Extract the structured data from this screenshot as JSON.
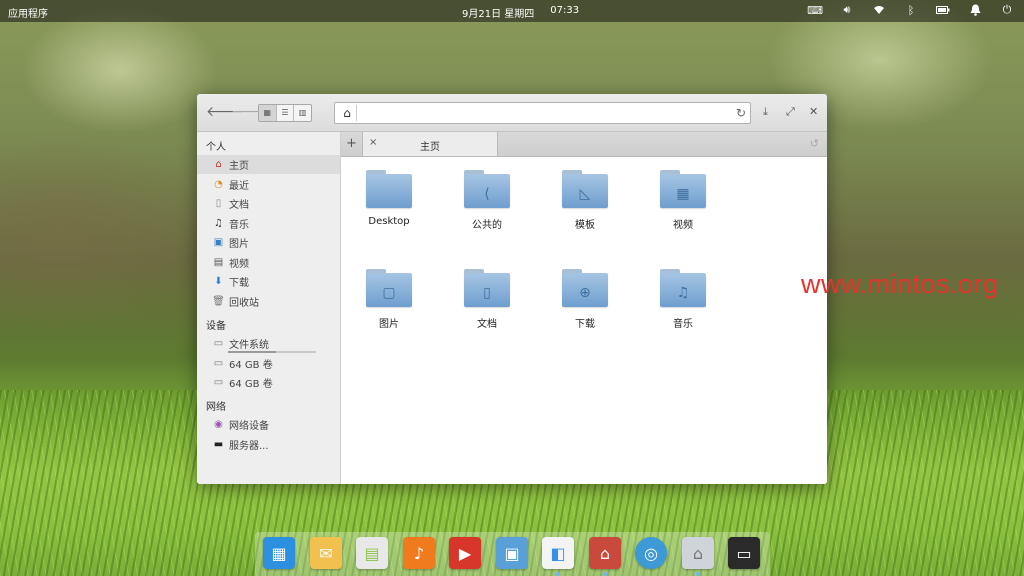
{
  "panel": {
    "apps_label": "应用程序",
    "date": "9月21日 星期四",
    "time": "07:33",
    "tray_icons": [
      "keyboard-icon",
      "volume-icon",
      "wifi-icon",
      "bluetooth-icon",
      "battery-icon",
      "notification-bell-icon",
      "power-icon"
    ]
  },
  "window": {
    "toolbar": {
      "back": "back-arrow-icon",
      "forward": "forward-arrow-icon",
      "view_modes": [
        "icon-view",
        "list-view",
        "column-view"
      ],
      "address_home": "home-icon",
      "address_text": "",
      "reload": "reload-icon",
      "controls": [
        "download-icon",
        "maximize-icon",
        "close-icon"
      ]
    },
    "sidebar": {
      "personal_title": "个人",
      "personal": [
        {
          "label": "主页",
          "icon": "home-icon",
          "selected": true
        },
        {
          "label": "最近",
          "icon": "recent-icon"
        },
        {
          "label": "文档",
          "icon": "document-icon"
        },
        {
          "label": "音乐",
          "icon": "music-icon"
        },
        {
          "label": "图片",
          "icon": "picture-icon"
        },
        {
          "label": "视频",
          "icon": "video-icon"
        },
        {
          "label": "下载",
          "icon": "download-icon"
        },
        {
          "label": "回收站",
          "icon": "trash-icon"
        }
      ],
      "devices_title": "设备",
      "devices": [
        {
          "label": "文件系统",
          "icon": "drive-icon",
          "usage": 0.55
        },
        {
          "label": "64 GB 卷",
          "icon": "drive-icon"
        },
        {
          "label": "64 GB 卷",
          "icon": "drive-icon"
        }
      ],
      "network_title": "网络",
      "network": [
        {
          "label": "网络设备",
          "icon": "network-icon"
        },
        {
          "label": "服务器...",
          "icon": "server-icon"
        }
      ]
    },
    "tabs": {
      "add": "+",
      "close": "×",
      "active_title": "主页"
    },
    "folders": [
      {
        "name": "Desktop",
        "glyph": ""
      },
      {
        "name": "公共的",
        "glyph": "⟨"
      },
      {
        "name": "模板",
        "glyph": "◺"
      },
      {
        "name": "视频",
        "glyph": "▦"
      },
      {
        "name": "图片",
        "glyph": "▢"
      },
      {
        "name": "文档",
        "glyph": "▯"
      },
      {
        "name": "下载",
        "glyph": "⊕"
      },
      {
        "name": "音乐",
        "glyph": "♫"
      }
    ]
  },
  "watermark": "www.mintos.org",
  "dock": {
    "items": [
      {
        "name": "multitasking-icon",
        "color": "#2d8fe0"
      },
      {
        "name": "mail-icon",
        "color": "#f2c04e"
      },
      {
        "name": "calendar-icon",
        "color": "#e8e8e8"
      },
      {
        "name": "music-player-icon",
        "color": "#f07a1e"
      },
      {
        "name": "video-player-icon",
        "color": "#d8362b"
      },
      {
        "name": "photos-icon",
        "color": "#5aa0d8"
      },
      {
        "name": "settings-toggle-icon",
        "color": "#f4f4f4"
      },
      {
        "name": "app-store-icon",
        "color": "#c94a3c"
      },
      {
        "name": "browser-icon",
        "color": "#3e9ad6"
      },
      {
        "name": "files-icon",
        "color": "#cfd4da"
      },
      {
        "name": "screenshot-icon",
        "color": "#2a2a2a"
      }
    ]
  }
}
